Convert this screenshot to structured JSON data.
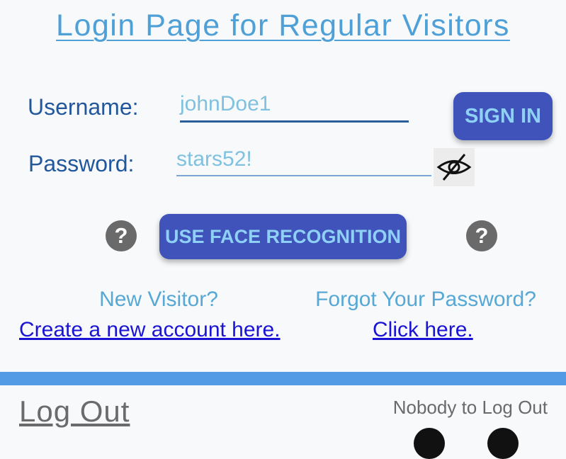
{
  "header": {
    "title": "Login Page for Regular Visitors"
  },
  "login_form": {
    "username_label": "Username:",
    "username_value": "johnDoe1",
    "password_label": "Password:",
    "password_value": "stars52!",
    "sign_in_label": "SIGN IN",
    "face_recognition_label": "USE FACE RECOGNITION",
    "help_glyph": "?"
  },
  "links": {
    "new_visitor_prompt": "New Visitor?",
    "create_account_link": "Create a new account here.",
    "forgot_password_prompt": "Forgot Your Password?",
    "click_here_link": "Click here."
  },
  "footer": {
    "logout_label": "Log Out",
    "status_text": "Nobody to Log Out"
  },
  "icons": {
    "password_visibility": "eye-slash-icon",
    "help": "question-circle-icon"
  },
  "colors": {
    "title": "#4fa0d6",
    "label": "#23579c",
    "input_text": "#7fc1de",
    "button_bg": "#3f53bb",
    "button_text": "#8fd0f5",
    "link": "#1a13d4",
    "divider": "#539be5"
  }
}
